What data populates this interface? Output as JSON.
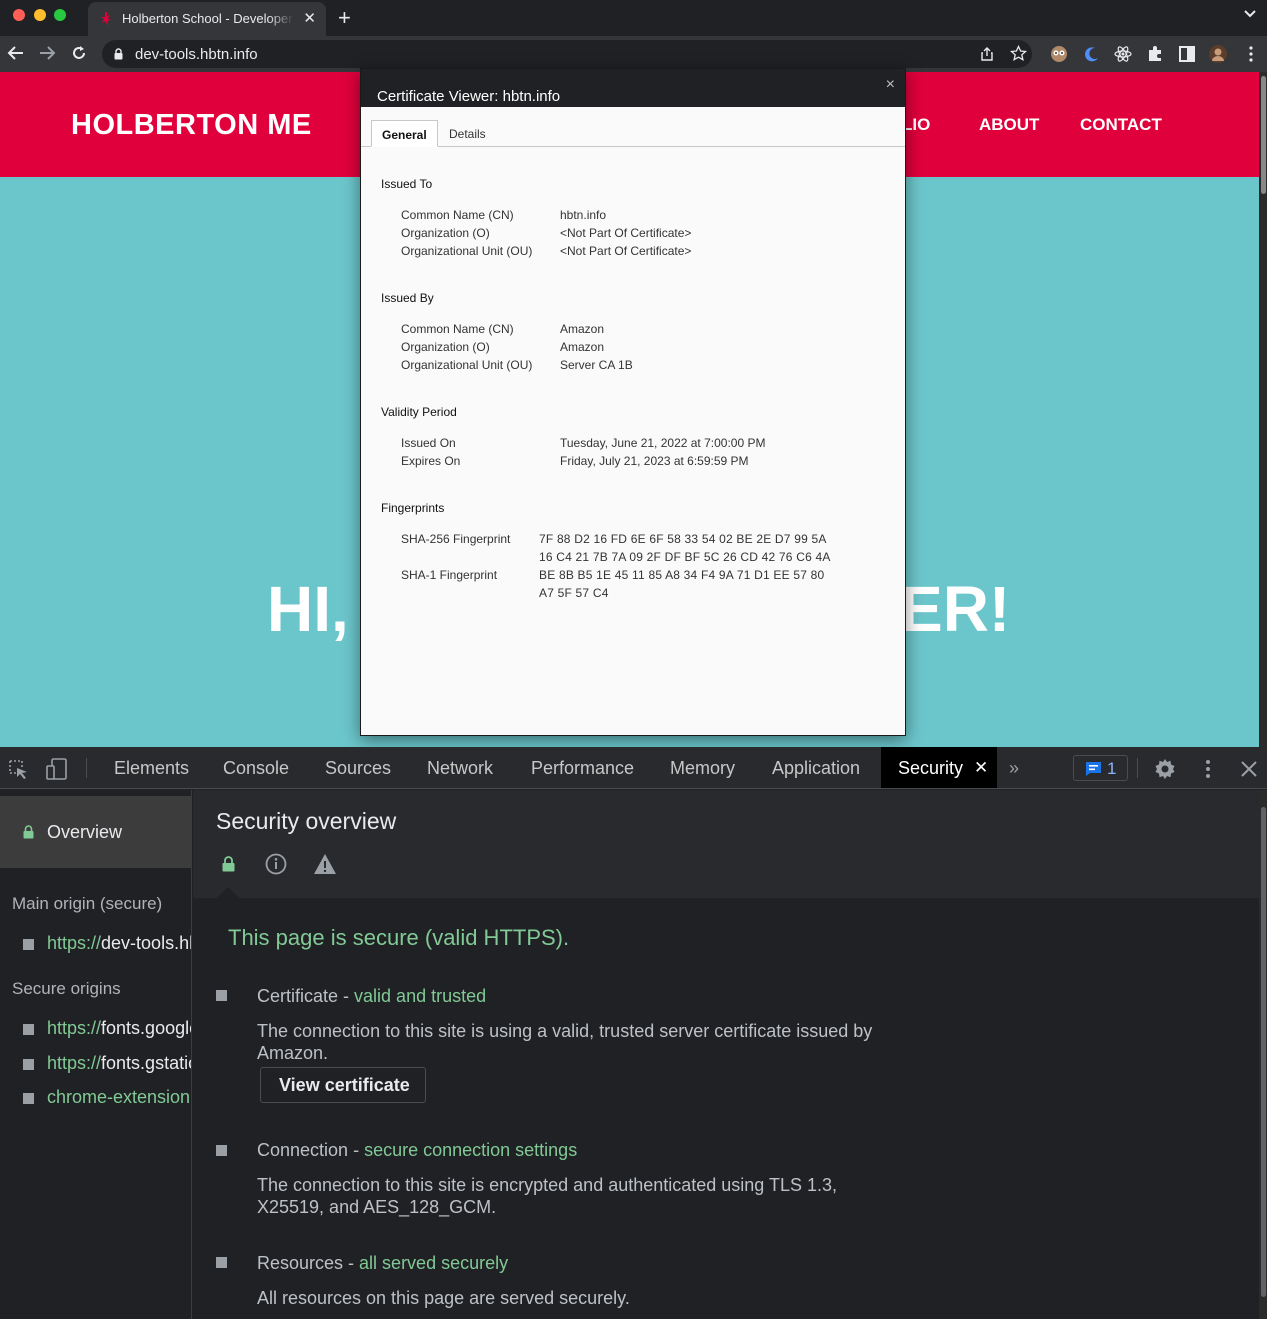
{
  "browser": {
    "tab_title": "Holberton School - Developer Tools",
    "url": "dev-tools.hbtn.info"
  },
  "website": {
    "logo": "HOLBERTON ME",
    "nav": [
      "LIO",
      "ABOUT",
      "CONTACT"
    ],
    "hero_left": "HI,",
    "hero_right": "ER!"
  },
  "cert": {
    "title": "Certificate Viewer: hbtn.info",
    "close": "×",
    "tabs": [
      "General",
      "Details"
    ],
    "issued_to": {
      "heading": "Issued To",
      "labels": [
        "Common Name (CN)",
        "Organization (O)",
        "Organizational Unit (OU)"
      ],
      "values": [
        "hbtn.info",
        "<Not Part Of Certificate>",
        "<Not Part Of Certificate>"
      ]
    },
    "issued_by": {
      "heading": "Issued By",
      "labels": [
        "Common Name (CN)",
        "Organization (O)",
        "Organizational Unit (OU)"
      ],
      "values": [
        "Amazon",
        "Amazon",
        "Server CA 1B"
      ]
    },
    "validity": {
      "heading": "Validity Period",
      "labels": [
        "Issued On",
        "Expires On"
      ],
      "values": [
        "Tuesday, June 21, 2022 at 7:00:00 PM",
        "Friday, July 21, 2023 at 6:59:59 PM"
      ]
    },
    "fingerprints": {
      "heading": "Fingerprints",
      "sha256_label": "SHA-256 Fingerprint",
      "sha256_lines": [
        "7F 88 D2 16 FD 6E 6F 58 33 54 02 BE 2E D7 99 5A",
        "16 C4 21 7B 7A 09 2F DF BF 5C 26 CD 42 76 C6 4A"
      ],
      "sha1_label": "SHA-1 Fingerprint",
      "sha1_lines": [
        "BE 8B B5 1E 45 11 85 A8 34 F4 9A 71 D1 EE 57 80",
        "A7 5F 57 C4"
      ]
    }
  },
  "devtools": {
    "tabs": [
      "Elements",
      "Console",
      "Sources",
      "Network",
      "Performance",
      "Memory",
      "Application"
    ],
    "active_tab": "Security",
    "more": "»",
    "issues_count": "1",
    "sidebar": {
      "overview": "Overview",
      "main_origin_heading": "Main origin (secure)",
      "main_origin": {
        "scheme": "https://",
        "host": "dev-tools.hbtn.info"
      },
      "secure_origins_heading": "Secure origins",
      "secure_origins": [
        {
          "scheme": "https://",
          "host": "fonts.googleapis.com"
        },
        {
          "scheme": "https://",
          "host": "fonts.gstatic.com"
        }
      ],
      "extension_origin": "chrome-extension://"
    },
    "main": {
      "title": "Security overview",
      "secure_message": "This page is secure (valid HTTPS).",
      "certificate": {
        "label": "Certificate - ",
        "status": "valid and trusted",
        "description": "The connection to this site is using a valid, trusted server certificate issued by Amazon.",
        "button": "View certificate"
      },
      "connection": {
        "label": "Connection - ",
        "status": "secure connection settings",
        "description": "The connection to this site is encrypted and authenticated using TLS 1.3, X25519, and AES_128_GCM."
      },
      "resources": {
        "label": "Resources - ",
        "status": "all served securely",
        "description": "All resources on this page are served securely."
      }
    }
  },
  "colors": {
    "site_header": "#e0003c",
    "site_body": "#6bc6cb",
    "secure_green": "#81c995",
    "devtools_bg": "#202124"
  }
}
